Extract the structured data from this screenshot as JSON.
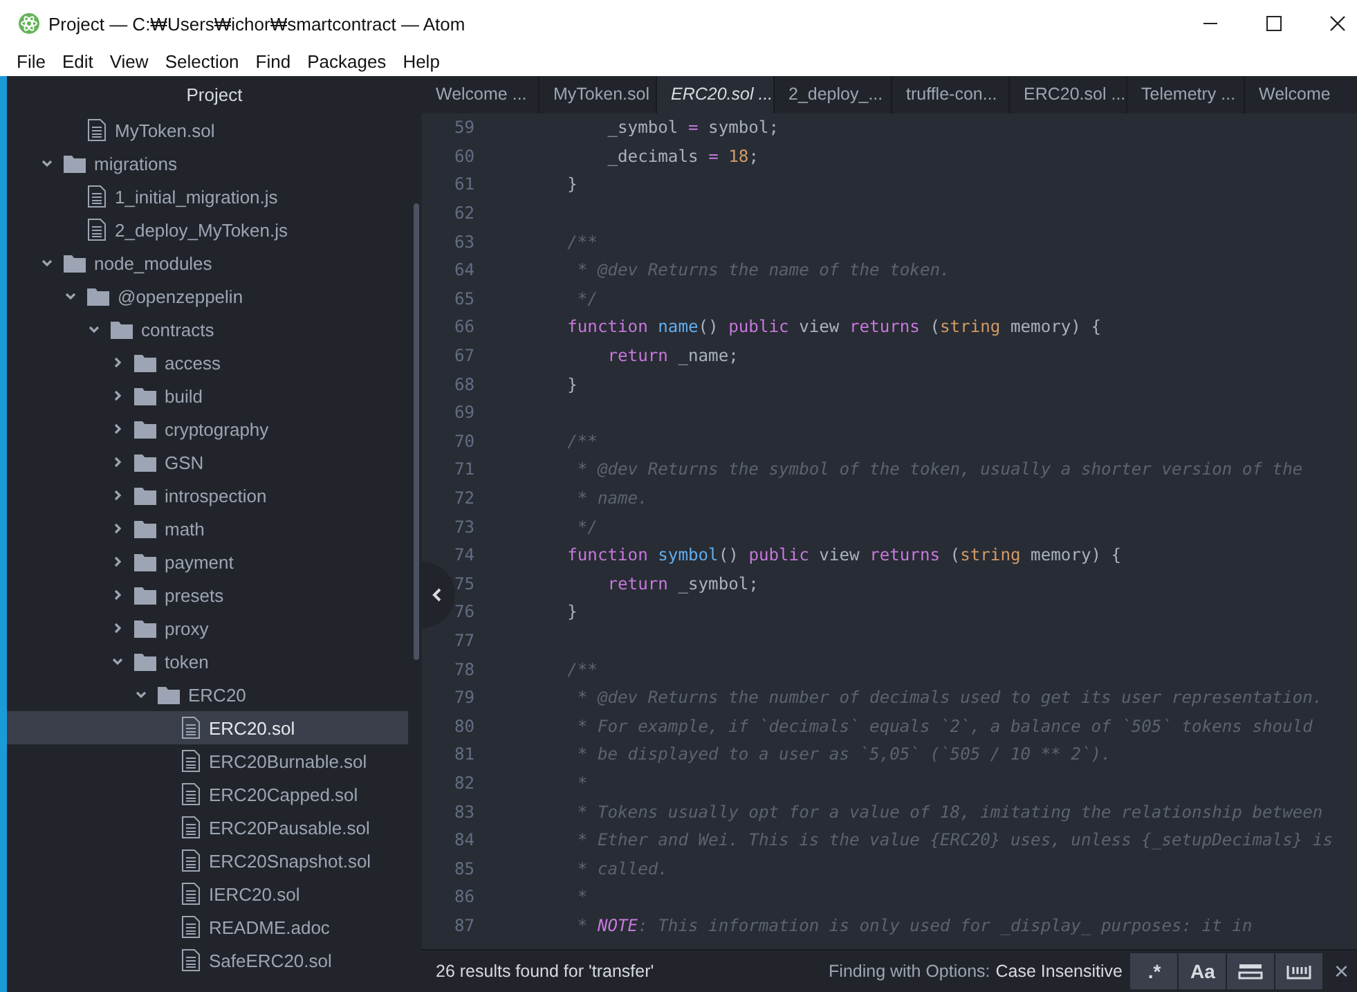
{
  "window": {
    "title": "Project — C:₩Users₩ichor₩smartcontract — Atom"
  },
  "menu": [
    "File",
    "Edit",
    "View",
    "Selection",
    "Find",
    "Packages",
    "Help"
  ],
  "sidebar": {
    "title": "Project",
    "partial_top": [
      {
        "name": "MyToken.sol",
        "kind": "file",
        "selected": false
      }
    ],
    "tree": [
      {
        "name": "migrations",
        "kind": "folder",
        "expanded": true,
        "selected": false,
        "children": [
          {
            "name": "1_initial_migration.js",
            "kind": "file",
            "selected": false
          },
          {
            "name": "2_deploy_MyToken.js",
            "kind": "file",
            "selected": false
          }
        ]
      },
      {
        "name": "node_modules",
        "kind": "folder",
        "expanded": true,
        "selected": false,
        "children": [
          {
            "name": "@openzeppelin",
            "kind": "folder",
            "expanded": true,
            "selected": false,
            "children": [
              {
                "name": "contracts",
                "kind": "folder",
                "expanded": true,
                "selected": false,
                "children": [
                  {
                    "name": "access",
                    "kind": "folder",
                    "expanded": false,
                    "selected": false
                  },
                  {
                    "name": "build",
                    "kind": "folder",
                    "expanded": false,
                    "selected": false
                  },
                  {
                    "name": "cryptography",
                    "kind": "folder",
                    "expanded": false,
                    "selected": false
                  },
                  {
                    "name": "GSN",
                    "kind": "folder",
                    "expanded": false,
                    "selected": false
                  },
                  {
                    "name": "introspection",
                    "kind": "folder",
                    "expanded": false,
                    "selected": false
                  },
                  {
                    "name": "math",
                    "kind": "folder",
                    "expanded": false,
                    "selected": false
                  },
                  {
                    "name": "payment",
                    "kind": "folder",
                    "expanded": false,
                    "selected": false
                  },
                  {
                    "name": "presets",
                    "kind": "folder",
                    "expanded": false,
                    "selected": false
                  },
                  {
                    "name": "proxy",
                    "kind": "folder",
                    "expanded": false,
                    "selected": false
                  },
                  {
                    "name": "token",
                    "kind": "folder",
                    "expanded": true,
                    "selected": false,
                    "children": [
                      {
                        "name": "ERC20",
                        "kind": "folder",
                        "expanded": true,
                        "selected": false,
                        "children": [
                          {
                            "name": "ERC20.sol",
                            "kind": "file",
                            "selected": true
                          },
                          {
                            "name": "ERC20Burnable.sol",
                            "kind": "file",
                            "selected": false
                          },
                          {
                            "name": "ERC20Capped.sol",
                            "kind": "file",
                            "selected": false
                          },
                          {
                            "name": "ERC20Pausable.sol",
                            "kind": "file",
                            "selected": false
                          },
                          {
                            "name": "ERC20Snapshot.sol",
                            "kind": "file",
                            "selected": false
                          },
                          {
                            "name": "IERC20.sol",
                            "kind": "file",
                            "selected": false
                          },
                          {
                            "name": "README.adoc",
                            "kind": "file",
                            "selected": false
                          },
                          {
                            "name": "SafeERC20.sol",
                            "kind": "file",
                            "selected": false
                          }
                        ]
                      }
                    ]
                  }
                ]
              }
            ]
          }
        ]
      }
    ]
  },
  "tabs": [
    {
      "label": "Welcome ...",
      "selected": false,
      "pending": false
    },
    {
      "label": "MyToken.sol",
      "selected": false,
      "pending": false
    },
    {
      "label": "ERC20.sol ...",
      "selected": true,
      "pending": true
    },
    {
      "label": "2_deploy_...",
      "selected": false,
      "pending": false
    },
    {
      "label": "truffle-con...",
      "selected": false,
      "pending": false
    },
    {
      "label": "ERC20.sol ...",
      "selected": false,
      "pending": false
    },
    {
      "label": "Telemetry ...",
      "selected": false,
      "pending": false
    },
    {
      "label": "Welcome",
      "selected": false,
      "pending": false
    }
  ],
  "editor": {
    "lines": [
      {
        "number": "59",
        "segments": [
          {
            "kind": "plain",
            "text": "        _symbol "
          },
          {
            "kind": "op",
            "text": "="
          },
          {
            "kind": "plain",
            "text": " symbol;"
          }
        ]
      },
      {
        "number": "60",
        "segments": [
          {
            "kind": "plain",
            "text": "        _decimals "
          },
          {
            "kind": "op",
            "text": "= "
          },
          {
            "kind": "number",
            "text": "18"
          },
          {
            "kind": "plain",
            "text": ";"
          }
        ]
      },
      {
        "number": "61",
        "segments": [
          {
            "kind": "plain",
            "text": "    }"
          }
        ]
      },
      {
        "number": "62"
      },
      {
        "number": "63",
        "segments": [
          {
            "kind": "comment",
            "text": "    /**"
          }
        ]
      },
      {
        "number": "64",
        "segments": [
          {
            "kind": "comment",
            "text": "     * @dev Returns the name of the token."
          }
        ]
      },
      {
        "number": "65",
        "segments": [
          {
            "kind": "comment",
            "text": "     */"
          }
        ]
      },
      {
        "number": "66",
        "segments": [
          {
            "kind": "keyword",
            "text": "    function "
          },
          {
            "kind": "function",
            "text": "name"
          },
          {
            "kind": "plain",
            "text": "() "
          },
          {
            "kind": "keyword",
            "text": "public"
          },
          {
            "kind": "plain",
            "text": " view "
          },
          {
            "kind": "keyword",
            "text": "returns"
          },
          {
            "kind": "plain",
            "text": " ("
          },
          {
            "kind": "type",
            "text": "string"
          },
          {
            "kind": "plain",
            "text": " memory) {"
          }
        ]
      },
      {
        "number": "67",
        "segments": [
          {
            "kind": "keyword",
            "text": "        return"
          },
          {
            "kind": "plain",
            "text": " _name;"
          }
        ]
      },
      {
        "number": "68",
        "segments": [
          {
            "kind": "plain",
            "text": "    }"
          }
        ]
      },
      {
        "number": "69"
      },
      {
        "number": "70",
        "segments": [
          {
            "kind": "comment",
            "text": "    /**"
          }
        ]
      },
      {
        "number": "71",
        "segments": [
          {
            "kind": "comment",
            "text": "     * @dev Returns the symbol of the token, usually a shorter version of the"
          }
        ]
      },
      {
        "number": "72",
        "segments": [
          {
            "kind": "comment",
            "text": "     * name."
          }
        ]
      },
      {
        "number": "73",
        "segments": [
          {
            "kind": "comment",
            "text": "     */"
          }
        ]
      },
      {
        "number": "74",
        "segments": [
          {
            "kind": "keyword",
            "text": "    function "
          },
          {
            "kind": "function",
            "text": "symbol"
          },
          {
            "kind": "plain",
            "text": "() "
          },
          {
            "kind": "keyword",
            "text": "public"
          },
          {
            "kind": "plain",
            "text": " view "
          },
          {
            "kind": "keyword",
            "text": "returns"
          },
          {
            "kind": "plain",
            "text": " ("
          },
          {
            "kind": "type",
            "text": "string"
          },
          {
            "kind": "plain",
            "text": " memory) {"
          }
        ]
      },
      {
        "number": "75",
        "segments": [
          {
            "kind": "keyword",
            "text": "        return"
          },
          {
            "kind": "plain",
            "text": " _symbol;"
          }
        ]
      },
      {
        "number": "76",
        "segments": [
          {
            "kind": "plain",
            "text": "    }"
          }
        ]
      },
      {
        "number": "77"
      },
      {
        "number": "78",
        "segments": [
          {
            "kind": "comment",
            "text": "    /**"
          }
        ]
      },
      {
        "number": "79",
        "segments": [
          {
            "kind": "comment",
            "text": "     * @dev Returns the number of decimals used to get its user representation."
          }
        ]
      },
      {
        "number": "80",
        "segments": [
          {
            "kind": "comment",
            "text": "     * For example, if `decimals` equals `2`, a balance of `505` tokens should"
          }
        ]
      },
      {
        "number": "81",
        "segments": [
          {
            "kind": "comment",
            "text": "     * be displayed to a user as `5,05` (`505 / 10 ** 2`)."
          }
        ]
      },
      {
        "number": "82",
        "segments": [
          {
            "kind": "comment",
            "text": "     *"
          }
        ]
      },
      {
        "number": "83",
        "segments": [
          {
            "kind": "comment",
            "text": "     * Tokens usually opt for a value of 18, imitating the relationship between"
          }
        ]
      },
      {
        "number": "84",
        "segments": [
          {
            "kind": "comment",
            "text": "     * Ether and Wei. This is the value {ERC20} uses, unless {_setupDecimals} is"
          }
        ]
      },
      {
        "number": "85",
        "segments": [
          {
            "kind": "comment",
            "text": "     * called."
          }
        ]
      },
      {
        "number": "86",
        "segments": [
          {
            "kind": "comment",
            "text": "     *"
          }
        ]
      },
      {
        "number": "87",
        "segments": [
          {
            "kind": "comment",
            "text": "     * "
          },
          {
            "kind": "note",
            "text": "NOTE"
          },
          {
            "kind": "comment",
            "text": ": This information is only used for _display_ purposes: it in"
          }
        ]
      }
    ]
  },
  "find_bar": {
    "results": "26 results found for 'transfer'",
    "options_label": "Finding with Options:",
    "options_value": "Case Insensitive",
    "toggles": [
      {
        "kind": "text",
        "label": ".*"
      },
      {
        "kind": "text",
        "label": "Aa"
      },
      {
        "kind": "selection"
      },
      {
        "kind": "word"
      }
    ],
    "close": "×"
  }
}
